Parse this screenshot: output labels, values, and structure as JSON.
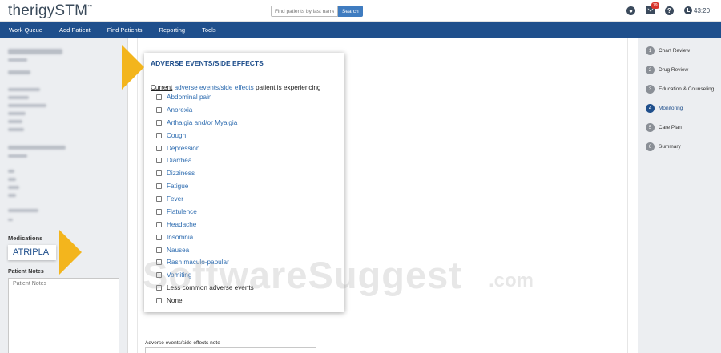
{
  "header": {
    "logo": "therigySTM",
    "logo_tm": "™",
    "search_placeholder": "Find patients by last name",
    "search_button": "Search",
    "mail_badge": "79",
    "user_icon": "user-circle-icon",
    "help_icon": "question-circle-icon",
    "clock_icon": "clock-icon",
    "timer": "43:20"
  },
  "nav": {
    "items": [
      "Work Queue",
      "Add Patient",
      "Find Patients",
      "Reporting",
      "Tools"
    ]
  },
  "sidebar": {
    "medications_label": "Medications",
    "medication": "ATRIPLA",
    "patient_notes_label": "Patient Notes",
    "patient_notes_placeholder": "Patient Notes"
  },
  "form": {
    "title": "ADVERSE EVENTS/SIDE EFFECTS",
    "subtitle_current": "Current",
    "subtitle_link": "adverse events/side effects",
    "subtitle_rest": "patient is experiencing",
    "options": [
      "Abdominal pain",
      "Anorexia",
      "Arthalgia and/or Myalgia",
      "Cough",
      "Depression",
      "Diarrhea",
      "Dizziness",
      "Fatigue",
      "Fever",
      "Flatulence",
      "Headache",
      "Insomnia",
      "Nausea",
      "Rash maculo-papular",
      "Vomiting",
      "Less common adverse events",
      "None"
    ],
    "note_label": "Adverse events/side effects note"
  },
  "steps": [
    {
      "num": "1",
      "label": "Chart Review"
    },
    {
      "num": "2",
      "label": "Drug Review"
    },
    {
      "num": "3",
      "label": "Education & Counseling"
    },
    {
      "num": "4",
      "label": "Monitoring"
    },
    {
      "num": "5",
      "label": "Care Plan"
    },
    {
      "num": "6",
      "label": "Summary"
    }
  ],
  "watermark": {
    "main": "SoftwareSuggest",
    "suffix": ".com"
  },
  "colors": {
    "nav_bg": "#1f4f8c",
    "accent": "#2e6cb0",
    "highlight_arrow": "#f3b51d",
    "badge": "#d9342b"
  }
}
